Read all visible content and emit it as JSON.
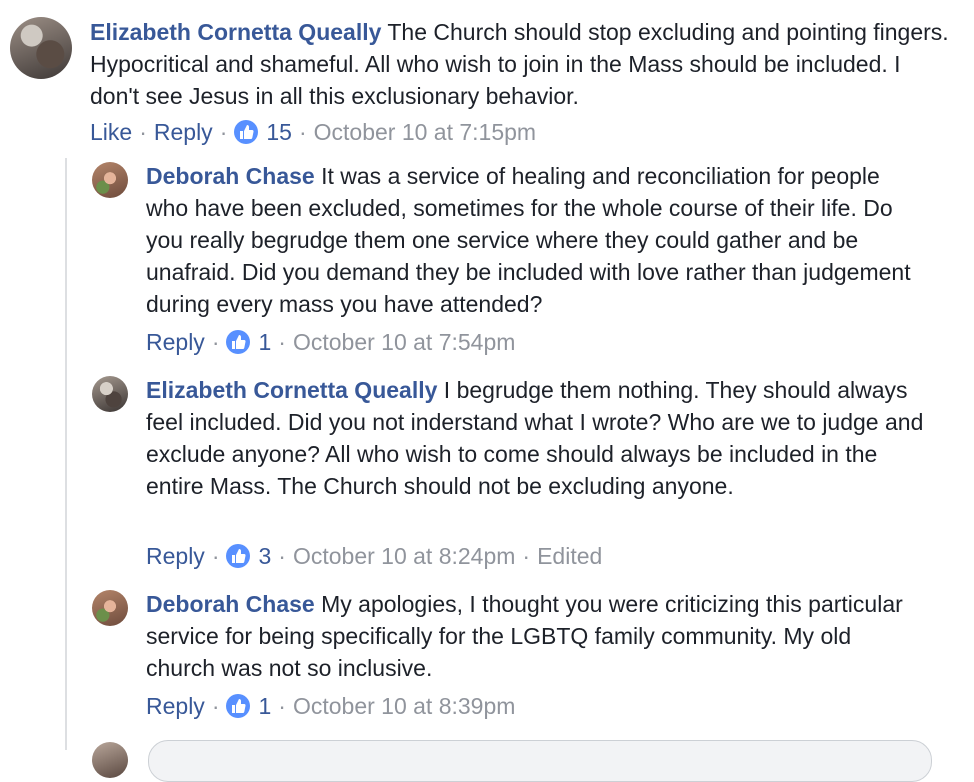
{
  "comments": [
    {
      "author": "Elizabeth Cornetta Queally",
      "text": " The Church should stop excluding and pointing fingers. Hypocritical and shameful. All who wish to join in the Mass should be included. I don't see Jesus in all this exclusionary behavior.",
      "like_label": "Like",
      "reply_label": "Reply",
      "reactions": "15",
      "timestamp": "October 10 at 7:15pm"
    }
  ],
  "replies": [
    {
      "author": "Deborah Chase",
      "text": " It was a service of healing and reconciliation for people who have been excluded, sometimes for the whole course of their life. Do you really begrudge them one service where they could gather and be unafraid. Did you demand they be included with love rather than judgement during every mass you have attended?",
      "reply_label": "Reply",
      "reactions": "1",
      "timestamp": "October 10 at 7:54pm"
    },
    {
      "author": "Elizabeth Cornetta Queally",
      "text": " I begrudge them nothing. They should always feel included. Did you not inderstand what I wrote? Who are we to judge and exclude anyone? All who wish to come should always be included in the entire Mass. The Church should not be excluding anyone.",
      "reply_label": "Reply",
      "reactions": "3",
      "timestamp": "October 10 at 8:24pm",
      "edited": "Edited"
    },
    {
      "author": "Deborah Chase",
      "text": " My apologies, I thought you were criticizing this particular service for being specifically for the LGBTQ family community. My old church was not so inclusive.",
      "reply_label": "Reply",
      "reactions": "1",
      "timestamp": "October 10 at 8:39pm"
    }
  ],
  "icons": {
    "reaction": "thumbs-up-icon"
  },
  "colors": {
    "author": "#385898",
    "meta": "#90949c",
    "like_badge": "#5890ff"
  }
}
